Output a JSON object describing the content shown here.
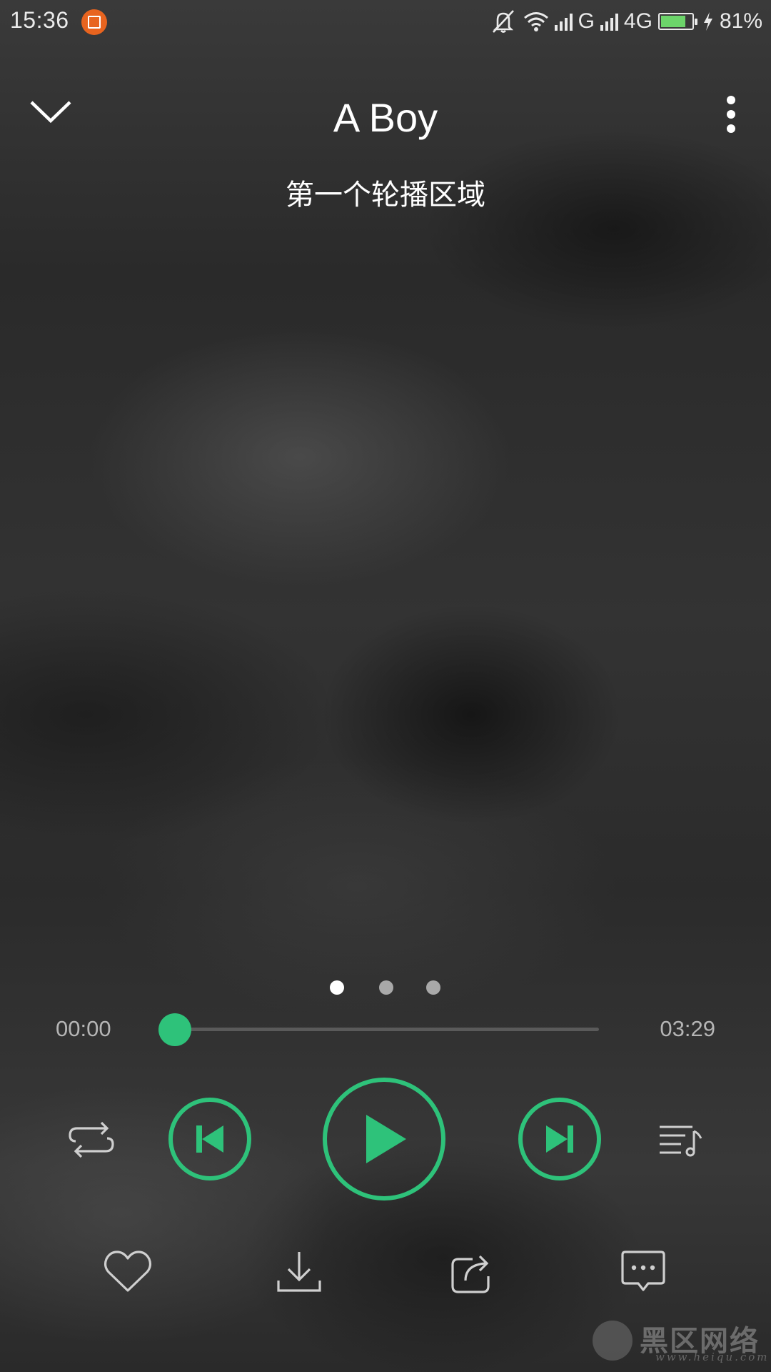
{
  "status_bar": {
    "time": "15:36",
    "network_g": "G",
    "network_4g": "4G",
    "battery_percent_text": "81%",
    "battery_level": 0.81,
    "icons": [
      "app-notification-icon",
      "mute-bell-icon",
      "wifi-icon",
      "signal-icon",
      "signal-icon",
      "battery-icon",
      "charging-bolt-icon"
    ]
  },
  "header": {
    "title": "A Boy",
    "carousel_label": "第一个轮播区域"
  },
  "pager": {
    "count": 3,
    "active_index": 0
  },
  "progress": {
    "current_time": "00:00",
    "total_time": "03:29",
    "fraction": 0.0
  },
  "controls": {
    "loop": "repeat-icon",
    "previous": "skip-previous-icon",
    "play": "play-icon",
    "next": "skip-next-icon",
    "playlist": "playlist-icon"
  },
  "actions": [
    "heart-icon",
    "download-icon",
    "share-icon",
    "comment-icon"
  ],
  "watermark": {
    "text": "黑区网络",
    "url": "www.heiqu.com"
  },
  "colors": {
    "accent": "#2ec27a",
    "text": "#ffffff",
    "secondary_text": "#b5b5b5"
  }
}
